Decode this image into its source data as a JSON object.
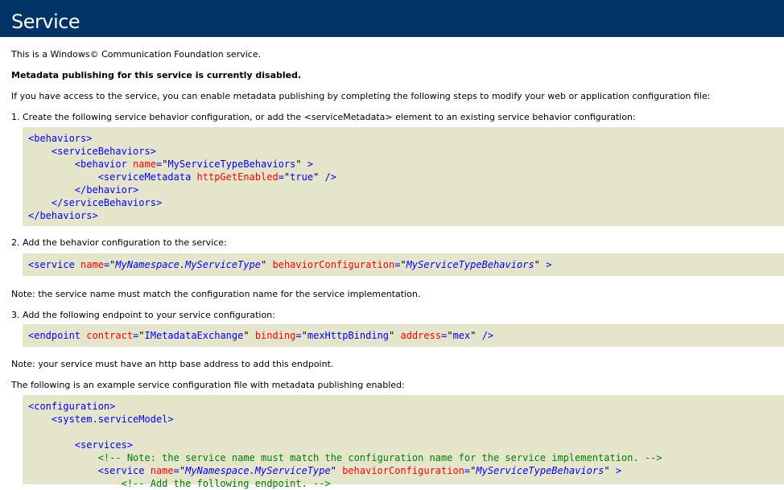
{
  "header": {
    "title": "Service"
  },
  "intro": {
    "p1": "This is a Windows© Communication Foundation service.",
    "p2": "Metadata publishing for this service is currently disabled.",
    "p3": "If you have access to the service, you can enable metadata publishing by completing the following steps to modify your web or application configuration file:"
  },
  "step1": {
    "text": "1. Create the following service behavior configuration, or add the <serviceMetadata> element to an existing service behavior configuration:",
    "code": {
      "behaviors_open": "<behaviors>",
      "serviceBehaviors_open": "<serviceBehaviors>",
      "behavior_tag": "<behavior",
      "name_attr": "name",
      "name_value": "MyServiceTypeBehaviors",
      "close_bracket": ">",
      "serviceMetadata_tag": "<serviceMetadata",
      "httpGetEnabled_attr": "httpGetEnabled",
      "httpGetEnabled_value": "true",
      "selfclose": "/>",
      "behavior_close": "</behavior>",
      "serviceBehaviors_close": "</serviceBehaviors>",
      "behaviors_close": "</behaviors>"
    }
  },
  "step2": {
    "text": "2. Add the behavior configuration to the service:",
    "code": {
      "service_tag": "<service",
      "name_attr": "name",
      "name_value": "MyNamespace.MyServiceType",
      "bc_attr": "behaviorConfiguration",
      "bc_value": "MyServiceTypeBehaviors",
      "close_bracket": ">"
    }
  },
  "note1": "Note: the service name must match the configuration name for the service implementation.",
  "step3": {
    "text": "3. Add the following endpoint to your service configuration:",
    "code": {
      "endpoint_tag": "<endpoint",
      "contract_attr": "contract",
      "contract_value": "IMetadataExchange",
      "binding_attr": "binding",
      "binding_value": "mexHttpBinding",
      "address_attr": "address",
      "address_value": "mex",
      "selfclose": "/>"
    }
  },
  "note2": "Note: your service must have an http base address to add this endpoint.",
  "example": {
    "text": "The following is an example service configuration file with metadata publishing enabled:",
    "code": {
      "configuration_open": "<configuration>",
      "systemServiceModel_open": "<system.serviceModel>",
      "services_open": "<services>",
      "comment1": "<!-- Note: the service name must match the configuration name for the service implementation. -->",
      "service_tag": "<service",
      "name_attr": "name",
      "name_value": "MyNamespace.MyServiceType",
      "bc_attr": "behaviorConfiguration",
      "bc_value": "MyServiceTypeBehaviors",
      "close_bracket": ">",
      "comment2_partial": "<!-- Add the following endpoint. -->"
    }
  },
  "colors": {
    "header_bg": "#003366",
    "code_bg": "#e5e5cc",
    "tag": "#0000ff",
    "attribute": "#ff0000",
    "comment": "#008000"
  }
}
